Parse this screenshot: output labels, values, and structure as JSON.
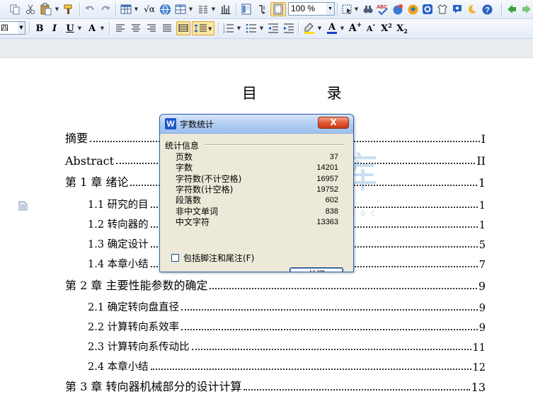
{
  "toolbar1": {
    "zoom_value": "100 %",
    "icons": [
      "copy-icon",
      "cut-icon",
      "paste-icon",
      "format-painter-icon",
      "undo-icon",
      "redo-icon",
      "table-icon",
      "formula-icon",
      "web-globe-icon",
      "grid-icon",
      "columns-icon",
      "chart-icon",
      "document-map-icon",
      "paragraph-mark-icon",
      "page-frame-icon",
      "select-icon",
      "find-icon",
      "spellcheck-icon",
      "share-icon",
      "wps-logo-icon",
      "pdf-icon",
      "shirt-skin-icon",
      "feedback-icon",
      "night-mode-icon",
      "help-icon",
      "back-icon",
      "forward-icon"
    ],
    "spellcheck_label": "ABC"
  },
  "toolbar2": {
    "font_name": "四",
    "bold": "B",
    "italic": "I",
    "underline": "U",
    "char_border": "A",
    "grow_font": "A",
    "shrink_font": "A",
    "superscript": "X",
    "sup_mark": "2",
    "subscript": "X",
    "sub_mark": "2",
    "font_color_letter": "A"
  },
  "colors": {
    "accent": "#2f5fb3",
    "close_red": "#e25a36",
    "highlight_yellow": "#ffe000",
    "font_color_blue": "#1b3fcf",
    "watermark_blue": "#3a8fd6"
  },
  "document": {
    "title": "目  录",
    "toc": [
      {
        "label": "摘要",
        "page": "I",
        "level": 1
      },
      {
        "label": "Abstract ",
        "page": "II",
        "level": 1
      },
      {
        "label": "第 1 章  绪论",
        "page": "1",
        "level": 1
      },
      {
        "label": "1.1 研究的目",
        "page": "1",
        "level": 2
      },
      {
        "label": "1.2 转向器的",
        "page": "1",
        "level": 2
      },
      {
        "label": "1.3  确定设计",
        "page": "5",
        "level": 2
      },
      {
        "label": "1.4  本章小结",
        "page": "7",
        "level": 2
      },
      {
        "label": "第 2 章  主要性能参数的确定",
        "page": "9",
        "level": 1
      },
      {
        "label": "2.1 确定转向盘直径",
        "page": "9",
        "level": 2
      },
      {
        "label": "2.2 计算转向系效率",
        "page": "9",
        "level": 2
      },
      {
        "label": "2.3 计算转向系传动比",
        "page": "11",
        "level": 2
      },
      {
        "label": "2.4  本章小结",
        "page": "12",
        "level": 2
      },
      {
        "label": "第 3 章  转向器机械部分的设计计算",
        "page": "13",
        "level": 1
      }
    ]
  },
  "dialog": {
    "title": "字数统计",
    "close_x": "X",
    "group_label": "统计信息",
    "stats": [
      {
        "label": "页数",
        "value": "37"
      },
      {
        "label": "字数",
        "value": "14201"
      },
      {
        "label": "字符数(不计空格)",
        "value": "16957"
      },
      {
        "label": "字符数(计空格)",
        "value": "19752"
      },
      {
        "label": "段落数",
        "value": "602"
      },
      {
        "label": "非中文单词",
        "value": "838"
      },
      {
        "label": "中文字符",
        "value": "13363"
      }
    ],
    "checkbox_label": "包括脚注和尾注(F)",
    "ok_label": "关闭"
  },
  "watermark": {
    "chars": "人文库",
    "url": "w w w . r e n r e n d o c . c o m"
  }
}
